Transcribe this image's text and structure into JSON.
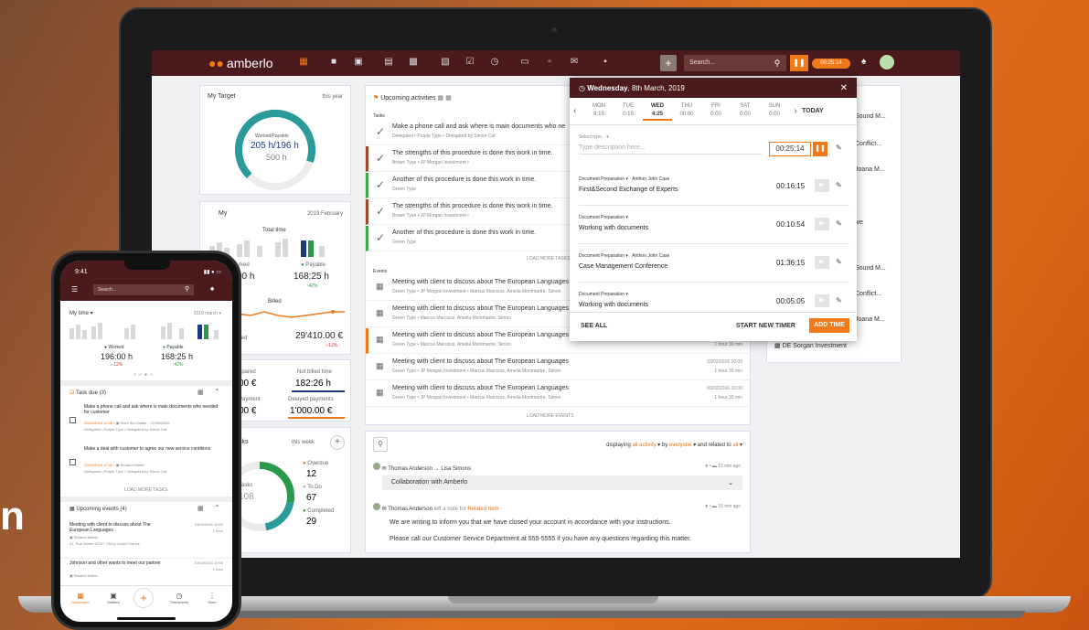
{
  "hero_text": "n",
  "app": {
    "brand": "amberlo",
    "search_placeholder": "Search...",
    "timer": "00:25:14"
  },
  "target_card": {
    "title": "My Target",
    "period": "this year",
    "gauge_label": "Worked/Payable",
    "gauge_value": "205 h/196 h",
    "gauge_sub": "500 h",
    "gauge_fraction": 0.41
  },
  "time_card": {
    "title": "My",
    "period": "2019 February",
    "total_label": "Total time",
    "worked_label": "rked",
    "worked_value": "00 h",
    "payable_label": "Payable",
    "payable_value": "168:25 h",
    "payable_change": "42%",
    "billed_label": "Billed",
    "billed_row_label": "lled",
    "billed_value": "29'410.00 €",
    "billed_change": "-12%"
  },
  "payments_card": {
    "prepared_label": "epared",
    "prepared_value": "00 €",
    "not_billed_label": "Not billed time",
    "not_billed_value": "182:26 h",
    "payment_label": "Payment",
    "payment_value": "00 €",
    "delayed_label": "Delayed payments",
    "delayed_value": "1'000.00 €"
  },
  "tasks_card": {
    "title": "sks",
    "period": "this week",
    "center_label": "Tasks",
    "center_value": "108",
    "overdue_label": "Overdue",
    "overdue_value": "12",
    "todo_label": "To Do",
    "todo_value": "67",
    "completed_label": "Completed",
    "completed_value": "29"
  },
  "activities": {
    "title": "Upcoming activities",
    "tasks_label": "Tasks",
    "tasks": [
      {
        "title": "Make a phone call and ask where is main documents who ne",
        "meta": "Delegated • Purple Type • Delegated by  Simon Cat",
        "color": "#ffffff"
      },
      {
        "title": "The strengths of this procedure is done this work in time.",
        "meta": "Brown Type •  JP Morgan Investment • ",
        "color": "#9a4a2a"
      },
      {
        "title": "Another of this procedure is done this work in time.",
        "meta": "Green Type",
        "color": "#3aaa4a"
      },
      {
        "title": "The strengths of this procedure is done this work in time.",
        "meta": "Brown Type •  JP Morgan Investment • ",
        "color": "#9a4a2a"
      },
      {
        "title": "Another of this procedure is done this work in time.",
        "meta": "Green Type",
        "color": "#3aaa4a"
      }
    ],
    "load_more_tasks": "LOAD MORE TASKS",
    "events_label": "Events",
    "events": [
      {
        "title": "Meeting with client to discuss about The European Languages",
        "meta": "Green Type •  JP Morgan Investment •  Marcus Marcizus, Amelia Montmartre, Simon",
        "date": "",
        "dur": "",
        "color": "#ffffff"
      },
      {
        "title": "Meeting with client to discuss about The European Languages",
        "meta": "Green Type •  Marcus Marcizus, Amelia Montmartre, Simon",
        "date": "",
        "dur": "",
        "color": "#ffffff"
      },
      {
        "title": "Meeting with client to discuss about The European Languages",
        "meta": "Green Type •  Marcus Marcizus, Amelia Montmartre, Simon",
        "date": "",
        "dur": "1 hour 30 min",
        "color": "#f07a1a"
      },
      {
        "title": "Meeting with client to discuss about The European Languages",
        "meta": "Green Type •  JP Morgan Investment •  Marcus Marcizus, Amelia Montmartre, Simon",
        "date": "03/02/2016 10:00",
        "dur": "1 hour 30 min",
        "color": "#ffffff"
      },
      {
        "title": "Meeting with client to discuss about The European Languages",
        "meta": "Green Type •  JP Morgan Investment •  Marcus Marcizus, Amelia Montmartre, Simon",
        "date": "03/02/2016 10:00",
        "dur": "1 hour 30 min",
        "color": "#ffffff"
      }
    ],
    "load_more_events": "LOAD MORE EVENTS"
  },
  "feed": {
    "displaying": "displaying",
    "filter_activity": "all activity",
    "by": "by",
    "filter_by": "everyone",
    "related_to": "and related to",
    "filter_related": "all",
    "items": [
      {
        "author": "Thomas Anderson",
        "arrow": "→",
        "target": "Lisa Simons",
        "time": "15 min ago",
        "subject": "Collaboration with Amberlo"
      },
      {
        "author": "Thomas Anderson",
        "action": "left a note for",
        "target": "Related Item",
        "time": "15 min ago",
        "line1": "We are writing to inform you that we have closed your account in accordance with your instructions.",
        "line2": "Please call our Customer Service Department at 555-5555 if you have any questions regarding this matter."
      }
    ]
  },
  "right_list": {
    "items": [
      "Sound M...",
      "Conflict...",
      "Joana M...",
      "ive",
      "Sound M...",
      "Conflict...",
      "Joana M..."
    ],
    "last": "DE Sorgan Investment"
  },
  "popup": {
    "weekday": "Wednesday",
    "date": ", 8th March, 2019",
    "days": [
      {
        "name": "MON",
        "time": "9:15"
      },
      {
        "name": "TUE",
        "time": "0:15"
      },
      {
        "name": "WED",
        "time": "4:25"
      },
      {
        "name": "THU",
        "time": "00:00"
      },
      {
        "name": "FRI",
        "time": "0:00"
      },
      {
        "name": "SAT",
        "time": "0:00"
      },
      {
        "name": "SUN",
        "time": "0:00"
      }
    ],
    "today": "TODAY",
    "select_type": "Select type...",
    "desc_placeholder": "Type description here...",
    "running_time": "00:25:14",
    "entries": [
      {
        "type": "Document Preparation",
        "client": "Anthon John Case",
        "desc": "First&Second Exchange of Experts",
        "time": "00:16:15"
      },
      {
        "type": "Document Preparation",
        "client": "",
        "desc": "Working with documents",
        "time": "00:10:54"
      },
      {
        "type": "Document Preparation",
        "client": "Anthon John Case",
        "desc": "Case Management Conference",
        "time": "01:36:15"
      },
      {
        "type": "Document Preparation",
        "client": "",
        "desc": "Working with documents",
        "time": "00:05:05"
      }
    ],
    "see_all": "SEE ALL",
    "start_new": "START NEW TIMER",
    "add_time": "ADD TIME"
  },
  "phone": {
    "clock": "9:41",
    "search_placeholder": "Search...",
    "my_time": "My time",
    "period": "2019 march",
    "worked_label": "Worked",
    "worked_value": "196:00 h",
    "worked_change": "-12%",
    "payable_label": "Payable",
    "payable_value": "168:25 h",
    "payable_change": "42%",
    "task_due": "Task due (3)",
    "tasks": [
      {
        "title": "Make a phone call and ask where is main documents who needed for customer",
        "date": "03/02/2016 10:00",
        "matter": "Slam Bro Matter - CD9584555",
        "meta": "Delegated • Purple Type • Delegated by  Simon Cat"
      },
      {
        "title": "Make a deal with customer to agree our new service contitions",
        "date": "03/02/2016 10:00",
        "matter": "Related Matter",
        "meta": "Delegated • Purple Type • Delegated by  Simon Cat"
      }
    ],
    "load_more": "LOAD MORE TASKS",
    "upcoming": "Upcoming events (4)",
    "events": [
      {
        "title": "Meeting with client to discuss about The European Languages",
        "date": "03/02/2016 10:00",
        "dur": "1 hour",
        "matter": "Related Matter",
        "place": "41, Rue Martre 92117 Clichy Cedex France"
      },
      {
        "title": "Johnson and other wants to meet our partner",
        "date": "03/02/2016 10:00",
        "dur": "1 hour",
        "matter": "Related Matter",
        "place": ""
      }
    ],
    "tabs": [
      "Dashboard",
      "Matters",
      "",
      "Timesheets",
      "More"
    ]
  }
}
